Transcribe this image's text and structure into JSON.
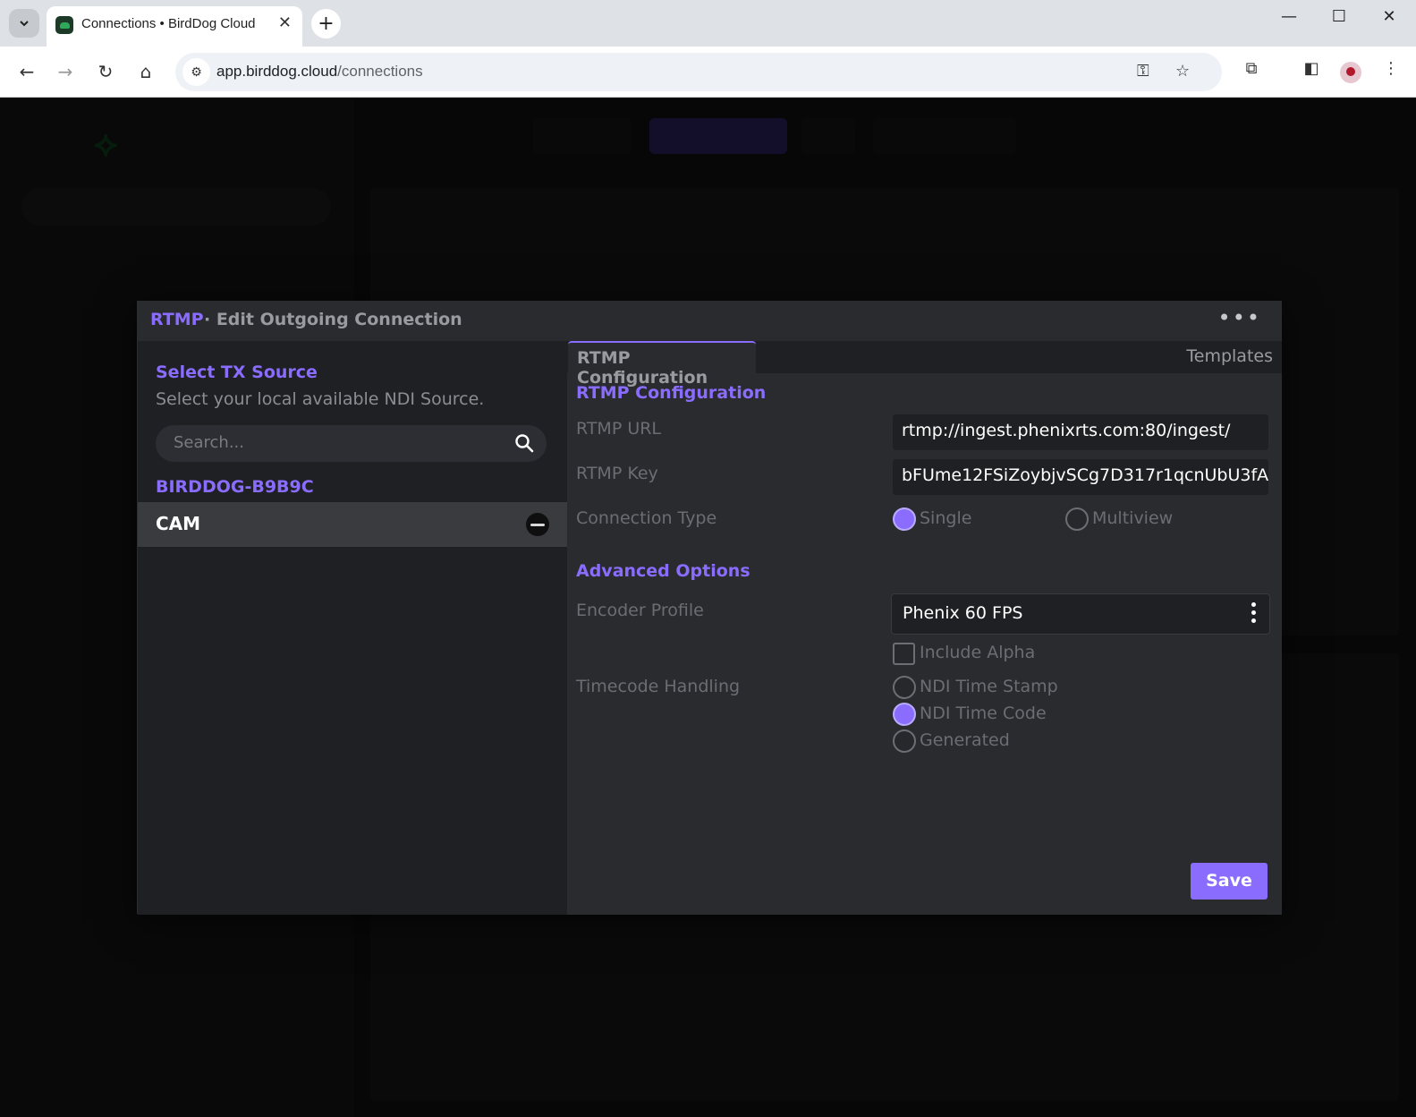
{
  "browser": {
    "tab_title": "Connections • BirdDog Cloud",
    "url_host": "app.birddog.cloud",
    "url_path": "/connections",
    "new_tab": "+",
    "tab_close": "✕"
  },
  "modal": {
    "header_protocol": "RTMP",
    "header_title": "· Edit Outgoing Connection",
    "more": "•••",
    "source": {
      "title": "Select TX Source",
      "subtitle": "Select your local available NDI Source.",
      "search_placeholder": "Search...",
      "group": "BIRDDOG-B9B9C",
      "items": [
        {
          "label": "CAM",
          "selected": true
        }
      ]
    },
    "tabs": {
      "active": "RTMP Configuration",
      "templates": "Templates"
    },
    "config": {
      "section_title": "RTMP Configuration",
      "rtmp_url_label": "RTMP URL",
      "rtmp_url_value": "rtmp://ingest.phenixrts.com:80/ingest/",
      "rtmp_key_label": "RTMP Key",
      "rtmp_key_value": "bFUme12FSiZoybjvSCg7D317r1qcnUbU3fA",
      "connection_type_label": "Connection Type",
      "connection_type_options": [
        "Single",
        "Multiview"
      ],
      "connection_type_selected": "Single"
    },
    "advanced": {
      "section_title": "Advanced Options",
      "encoder_profile_label": "Encoder Profile",
      "encoder_profile_value": "Phenix 60 FPS",
      "include_alpha_label": "Include Alpha",
      "include_alpha_checked": false,
      "timecode_label": "Timecode Handling",
      "timecode_options": [
        "NDI Time Stamp",
        "NDI Time Code",
        "Generated"
      ],
      "timecode_selected": "NDI Time Code"
    },
    "save_label": "Save"
  },
  "colors": {
    "accent": "#8a6cff",
    "modal_bg": "#1f2023",
    "panel_bg": "#2a2b2f"
  }
}
